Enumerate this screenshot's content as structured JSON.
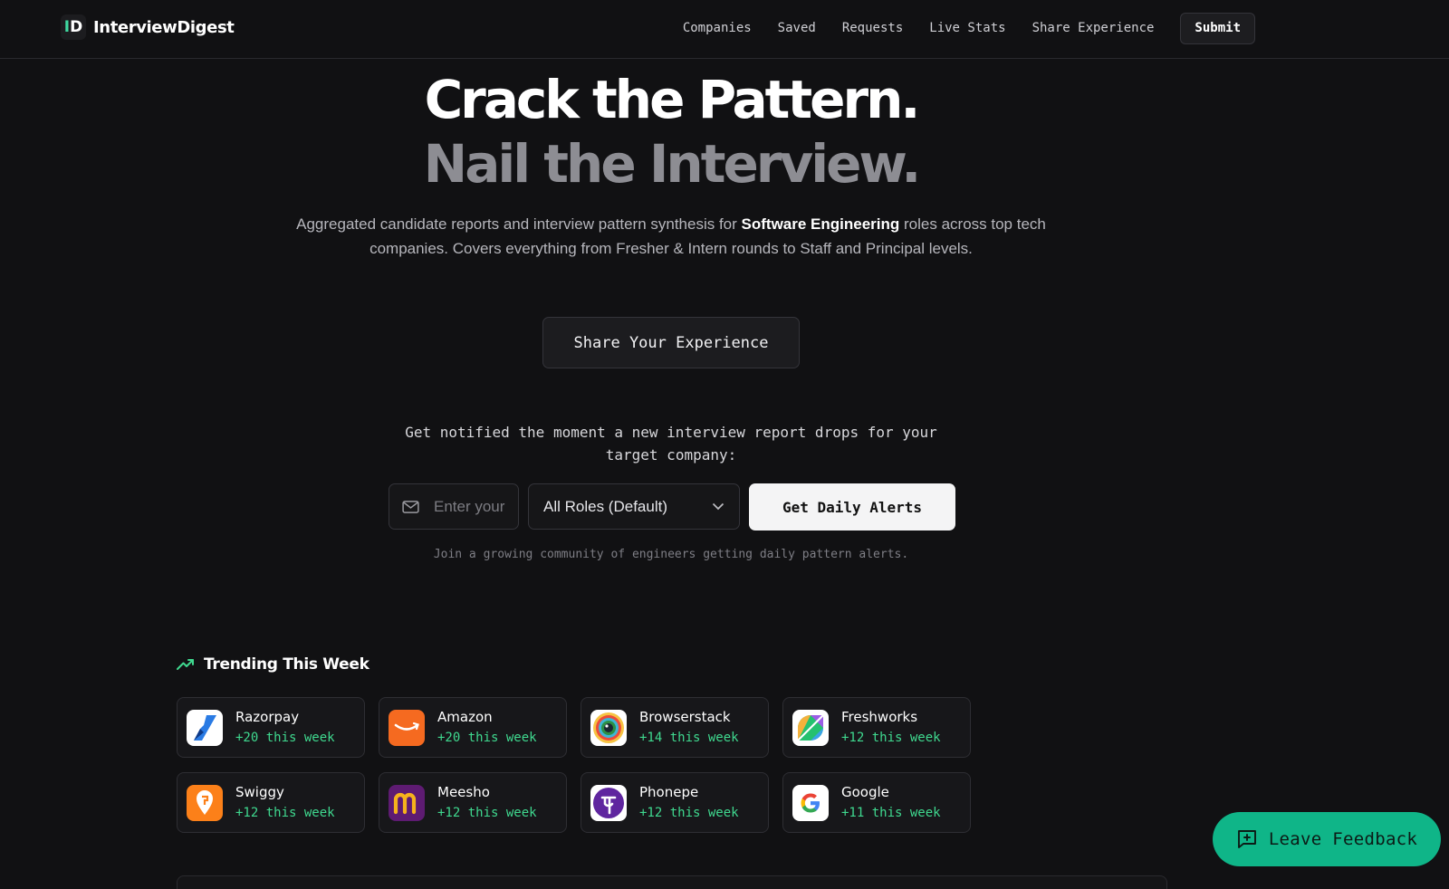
{
  "header": {
    "brand": "InterviewDigest",
    "brand_mark": "D",
    "nav": [
      "Companies",
      "Saved",
      "Requests",
      "Live Stats",
      "Share Experience"
    ],
    "submit_label": "Submit"
  },
  "hero": {
    "line1": "Crack the Pattern.",
    "line2": "Nail the Interview.",
    "sub_before": "Aggregated candidate reports and interview pattern synthesis for ",
    "sub_bold": "Software Engineering",
    "sub_after": " roles across top tech companies. Covers everything from Fresher & Intern rounds to Staff and Principal levels.",
    "share_label": "Share Your Experience"
  },
  "alerts": {
    "prompt": "Get notified the moment a new interview report drops for your target company:",
    "email_placeholder": "Enter your email",
    "role_value": "All Roles (Default)",
    "button": "Get Daily Alerts",
    "note": "Join a growing community of engineers getting daily pattern alerts."
  },
  "trending": {
    "title": "Trending This Week",
    "companies": [
      {
        "name": "Razorpay",
        "count": "+20 this week",
        "icon": "razorpay-logo"
      },
      {
        "name": "Amazon",
        "count": "+20 this week",
        "icon": "amazon-logo"
      },
      {
        "name": "Browserstack",
        "count": "+14 this week",
        "icon": "browserstack-logo"
      },
      {
        "name": "Freshworks",
        "count": "+12 this week",
        "icon": "freshworks-logo"
      },
      {
        "name": "Swiggy",
        "count": "+12 this week",
        "icon": "swiggy-logo"
      },
      {
        "name": "Meesho",
        "count": "+12 this week",
        "icon": "meesho-logo"
      },
      {
        "name": "Phonepe",
        "count": "+12 this week",
        "icon": "phonepe-logo"
      },
      {
        "name": "Google",
        "count": "+11 this week",
        "icon": "google-logo"
      }
    ]
  },
  "feedback": {
    "label": "Leave Feedback"
  },
  "colors": {
    "background": "#111113",
    "accent": "#0fb588",
    "trend_green": "#3fd98f"
  }
}
